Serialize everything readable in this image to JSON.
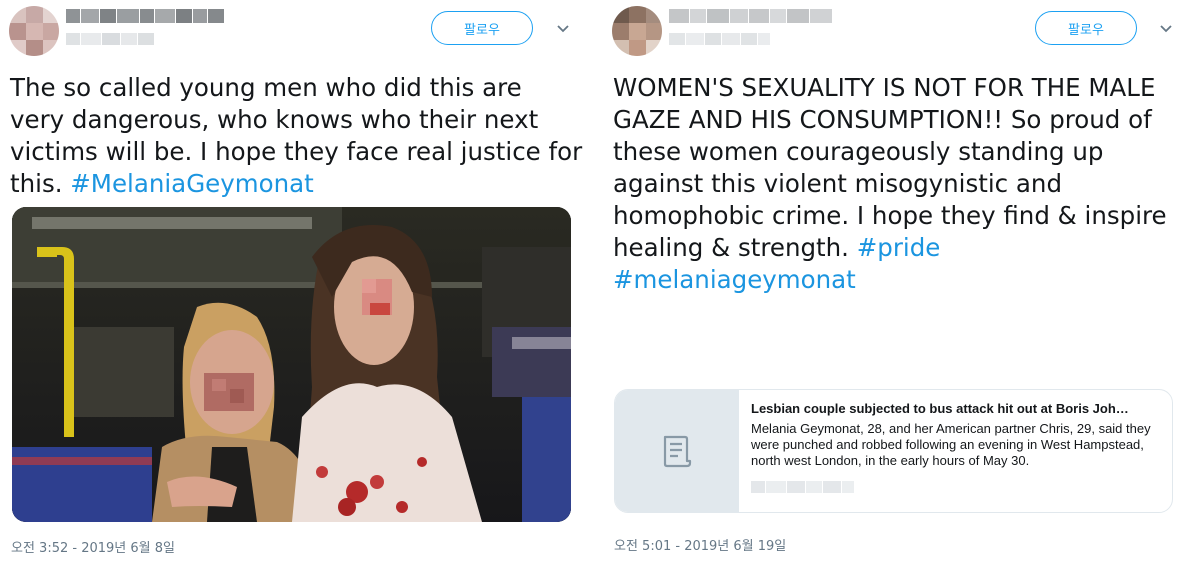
{
  "tweets": [
    {
      "follow_label": "팔로우",
      "text_lines": [
        "The so called young men who did this are",
        "very dangerous, who knows who their next",
        "victims will be. I hope they face real justice for"
      ],
      "last_line_text": "this. ",
      "hashtag": "#MelaniaGeymonat",
      "timestamp": "오전 3:52 - 2019년 6월 8일"
    },
    {
      "follow_label": "팔로우",
      "text_lines": [
        "WOMEN'S SEXUALITY IS NOT FOR THE MALE",
        "GAZE AND HIS CONSUMPTION!! So proud of",
        "these women courageously standing up",
        "against this violent misogynistic and",
        "homophobic crime. I hope they find & inspire"
      ],
      "line6_text": "healing & strength. ",
      "hashtag_pride": "#pride",
      "hashtag_melania": "#melaniageymonat",
      "card": {
        "title": "Lesbian couple subjected to bus attack hit out at Boris Joh…",
        "description": "Melania Geymonat, 28, and her American partner Chris, 29, said they were punched and robbed following an evening in West Hampstead, north west London, in the early hours of May 30.",
        "icon": "article-icon"
      },
      "timestamp": "오전 5:01 - 2019년 6월 19일"
    }
  ],
  "colors": {
    "hashtag": "#1b95e0",
    "follow": "#1da1f2",
    "muted": "#657786"
  }
}
